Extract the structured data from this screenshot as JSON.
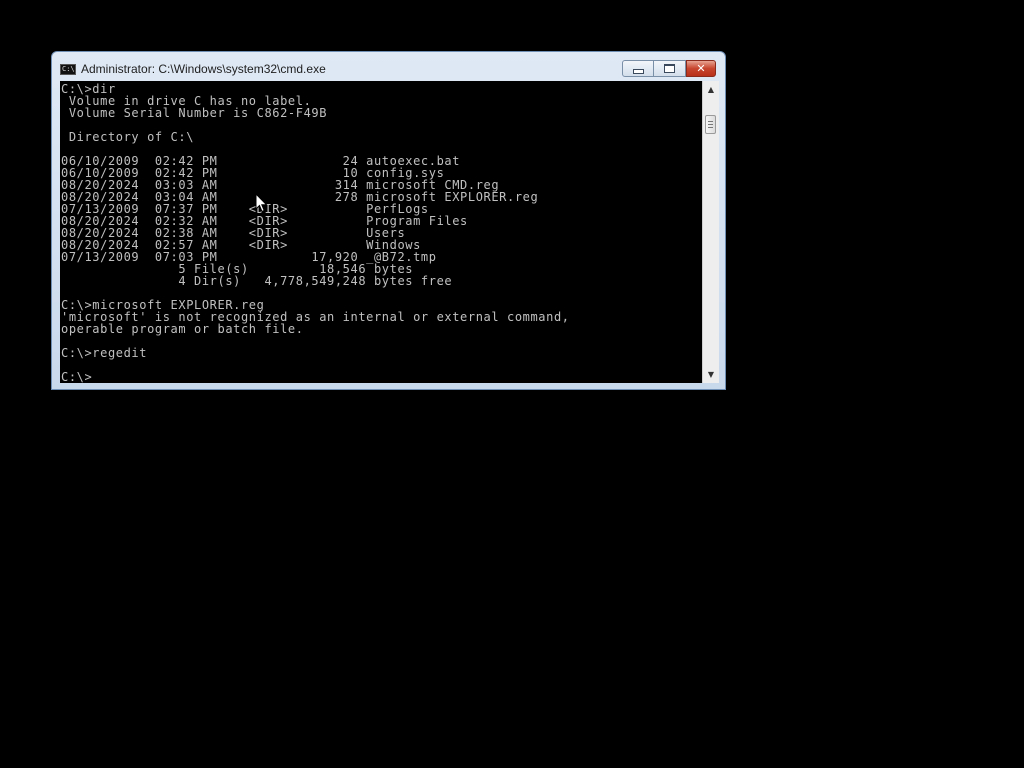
{
  "window": {
    "title": "Administrator: C:\\Windows\\system32\\cmd.exe",
    "icon_label": "C:\\",
    "close_glyph": "✕"
  },
  "console": {
    "lines": [
      "C:\\>dir",
      " Volume in drive C has no label.",
      " Volume Serial Number is C862-F49B",
      "",
      " Directory of C:\\",
      "",
      "06/10/2009  02:42 PM                24 autoexec.bat",
      "06/10/2009  02:42 PM                10 config.sys",
      "08/20/2024  03:03 AM               314 microsoft CMD.reg",
      "08/20/2024  03:04 AM               278 microsoft EXPLORER.reg",
      "07/13/2009  07:37 PM    <DIR>          PerfLogs",
      "08/20/2024  02:32 AM    <DIR>          Program Files",
      "08/20/2024  02:38 AM    <DIR>          Users",
      "08/20/2024  02:57 AM    <DIR>          Windows",
      "07/13/2009  07:03 PM            17,920 _@B72.tmp",
      "               5 File(s)         18,546 bytes",
      "               4 Dir(s)   4,778,549,248 bytes free",
      "",
      "C:\\>microsoft EXPLORER.reg",
      "'microsoft' is not recognized as an internal or external command,",
      "operable program or batch file.",
      "",
      "C:\\>regedit",
      "",
      "C:\\>"
    ]
  },
  "scrollbar": {
    "up_arrow": "▲",
    "down_arrow": "▼"
  },
  "colors": {
    "desktop": "#000000",
    "console_bg": "#000000",
    "console_text": "#c0c0c0",
    "window_frame": "#c9d9ec",
    "close_button": "#c7452e"
  }
}
